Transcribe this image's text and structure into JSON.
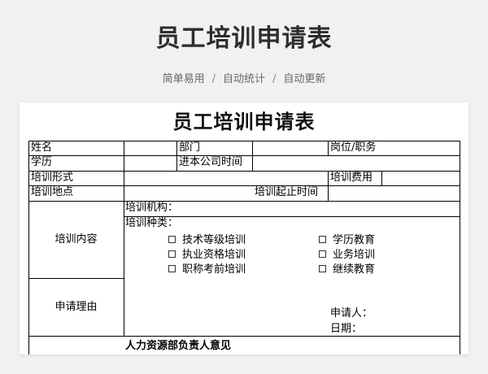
{
  "page": {
    "title": "员工培训申请表",
    "tags": [
      "简单易用",
      "自动统计",
      "自动更新"
    ],
    "tag_separator": "/"
  },
  "form": {
    "title": "员工培训申请表",
    "name": "姓名",
    "department": "部门",
    "position": "岗位/职务",
    "education": "学历",
    "join_date": "进本公司时间",
    "training_form": "培训形式",
    "training_fee": "培训费用",
    "training_location": "培训地点",
    "training_period": "培训起止时间",
    "training_content": "培训内容",
    "institution": "培训机构：",
    "category": "培训种类：",
    "options_left": [
      "技术等级培训",
      "执业资格培训",
      "职称考前培训"
    ],
    "options_right": [
      "学历教育",
      "业务培训",
      "继续教育"
    ],
    "reason": "申请理由",
    "applicant": "申请人：",
    "date": "日期：",
    "hr_opinion": "人力资源部负责人意见"
  }
}
